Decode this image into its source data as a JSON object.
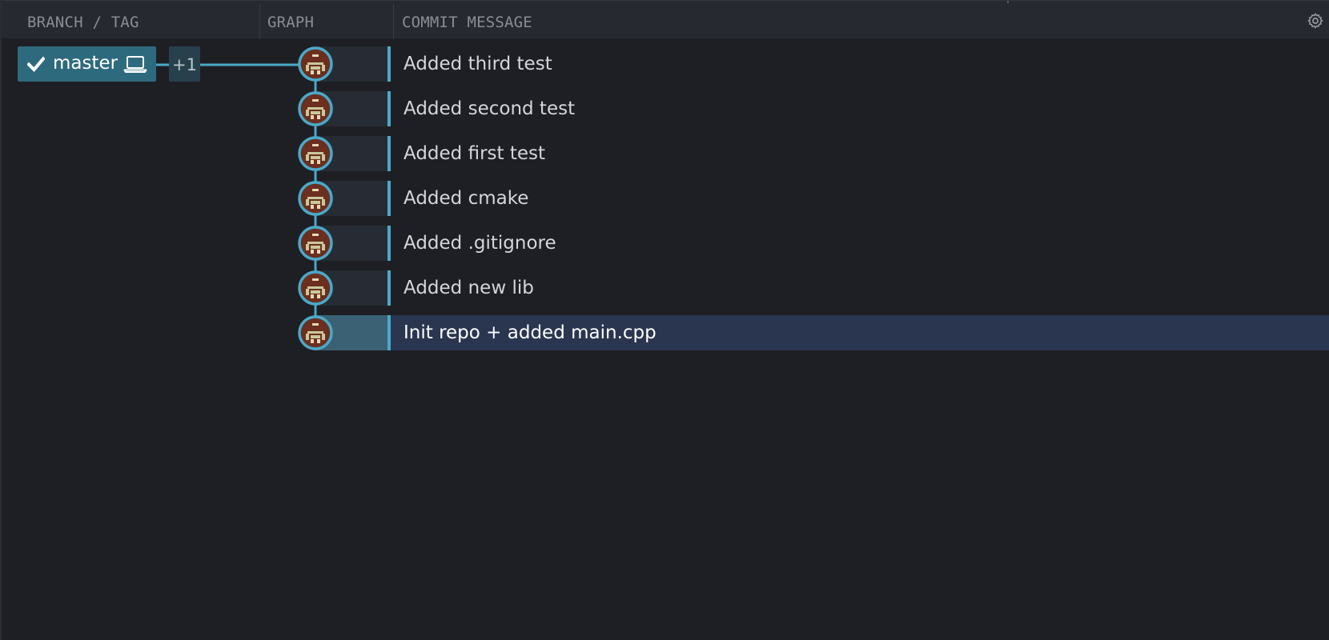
{
  "header": {
    "columns": {
      "branch_tag": "BRANCH / TAG",
      "graph": "GRAPH",
      "commit_message": "COMMIT MESSAGE"
    },
    "settings_icon": "gear-icon"
  },
  "branch": {
    "name": "master",
    "check_icon": "checkmark-icon",
    "local_icon": "laptop-icon",
    "extra_count": "+1"
  },
  "commits": [
    {
      "message": "Added third test",
      "selected": false
    },
    {
      "message": "Added second test",
      "selected": false
    },
    {
      "message": "Added first test",
      "selected": false
    },
    {
      "message": "Added cmake",
      "selected": false
    },
    {
      "message": "Added .gitignore",
      "selected": false
    },
    {
      "message": "Added new lib",
      "selected": false
    },
    {
      "message": "Init repo + added main.cpp",
      "selected": true
    }
  ],
  "colors": {
    "accent": "#4aa9c9",
    "branch_pill": "#2e6a7e",
    "selected_row": "#2a3550",
    "background": "#1e1f24"
  }
}
